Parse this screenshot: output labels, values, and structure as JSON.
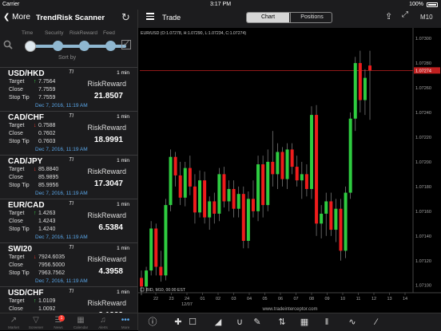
{
  "status_bar": {
    "carrier": "Carrier",
    "time": "3:17 PM",
    "battery": "100%"
  },
  "left_panel": {
    "back_label": "More",
    "title": "TrendRisk Scanner",
    "sort": {
      "options": [
        "Time",
        "Security",
        "RiskReward",
        "Feed"
      ],
      "label": "Sort by"
    },
    "items": [
      {
        "symbol": "USD/HKD",
        "ti": "TI",
        "timeframe": "1 min",
        "direction": "up",
        "target": "7.7564",
        "close": "7.7559",
        "stop": "7.7559",
        "rr_label": "RiskReward",
        "score": "21.8507",
        "date": "Dec 7, 2016, 11:19 AM",
        "labels": {
          "target": "Target",
          "close": "Close",
          "stop": "Stop Tip"
        }
      },
      {
        "symbol": "CAD/CHF",
        "ti": "TI",
        "timeframe": "1 min",
        "direction": "down",
        "target": "0.7588",
        "close": "0.7602",
        "stop": "0.7603",
        "rr_label": "RiskReward",
        "score": "18.9991",
        "date": "Dec 7, 2016, 11:19 AM",
        "labels": {
          "target": "Target",
          "close": "Close",
          "stop": "Stop Tip"
        }
      },
      {
        "symbol": "CAD/JPY",
        "ti": "TI",
        "timeframe": "1 min",
        "direction": "down",
        "target": "85.8840",
        "close": "85.9895",
        "stop": "85.9956",
        "rr_label": "RiskReward",
        "score": "17.3047",
        "date": "Dec 7, 2016, 11:19 AM",
        "labels": {
          "target": "Target",
          "close": "Close",
          "stop": "Stop Tip"
        }
      },
      {
        "symbol": "EUR/CAD",
        "ti": "TI",
        "timeframe": "1 min",
        "direction": "up",
        "target": "1.4263",
        "close": "1.4243",
        "stop": "1.4240",
        "rr_label": "RiskReward",
        "score": "6.5384",
        "date": "Dec 7, 2016, 11:19 AM",
        "labels": {
          "target": "Target",
          "close": "Close",
          "stop": "Stop Tip"
        }
      },
      {
        "symbol": "SWI20",
        "ti": "TI",
        "timeframe": "1 min",
        "direction": "down",
        "target": "7924.6035",
        "close": "7956.5000",
        "stop": "7963.7562",
        "rr_label": "RiskReward",
        "score": "4.3958",
        "date": "Dec 7, 2016, 11:19 AM",
        "labels": {
          "target": "Target",
          "close": "Close",
          "stop": "Stop Tip"
        }
      },
      {
        "symbol": "USD/CHF",
        "ti": "TI",
        "timeframe": "1 min",
        "direction": "up",
        "target": "1.0109",
        "close": "1.0092",
        "stop": "1.0086",
        "rr_label": "RiskReward",
        "score": "3.1333",
        "date": "",
        "labels": {
          "target": "Target",
          "close": "Close",
          "stop": "Stop Tip"
        }
      }
    ],
    "tabs": [
      {
        "label": "Market",
        "icon": "chart-icon"
      },
      {
        "label": "Screener",
        "icon": "filter-icon"
      },
      {
        "label": "News",
        "icon": "news-icon",
        "badge": "1"
      },
      {
        "label": "Calendar",
        "icon": "calendar-icon"
      },
      {
        "label": "Alerts",
        "icon": "bell-icon"
      },
      {
        "label": "More",
        "icon": "more-icon"
      }
    ]
  },
  "right_panel": {
    "title": "Trade",
    "segments": [
      "Chart",
      "Positions"
    ],
    "period": "M10",
    "chart_header": "EUR/USD (O:1.07278, H:1.07290, L:1.07234, C:1.07274)",
    "chart_footer": "BID, M10, 00:00 EST",
    "watermark": "www.tradeinterceptor.com",
    "toolbar_icons": [
      "info-icon",
      "crosshair-icon",
      "crop-icon",
      "area-chart-icon",
      "magnet-icon",
      "pencil-icon",
      "sort-icon",
      "grid-icon",
      "columns-icon",
      "indicator-icon",
      "link-icon"
    ]
  },
  "chart_data": {
    "type": "candlestick",
    "symbol": "EUR/USD",
    "y_ticks": [
      "1.07300",
      "1.07280",
      "1.07260",
      "1.07240",
      "1.07220",
      "1.07200",
      "1.07180",
      "1.07160",
      "1.07140",
      "1.07120",
      "1.07100"
    ],
    "x_ticks": [
      "22",
      "23",
      "24",
      "01",
      "02",
      "03",
      "04",
      "05",
      "06",
      "07",
      "08",
      "09",
      "10",
      "11",
      "12",
      "13",
      "14"
    ],
    "x_sublabel": "12/07",
    "last_price": "1.07274",
    "ylim": [
      1.07094,
      1.07302
    ],
    "up_color": "#2ecc40",
    "down_color": "#ee1c1c",
    "candles": [
      {
        "o": 1.07106,
        "h": 1.07112,
        "l": 1.07092,
        "c": 1.07099
      },
      {
        "o": 1.07099,
        "h": 1.07115,
        "l": 1.07094,
        "c": 1.07112
      },
      {
        "o": 1.07112,
        "h": 1.07152,
        "l": 1.07108,
        "c": 1.07146
      },
      {
        "o": 1.07146,
        "h": 1.0715,
        "l": 1.07108,
        "c": 1.07115
      },
      {
        "o": 1.07115,
        "h": 1.07128,
        "l": 1.07103,
        "c": 1.07108
      },
      {
        "o": 1.07108,
        "h": 1.0717,
        "l": 1.07104,
        "c": 1.07165
      },
      {
        "o": 1.07165,
        "h": 1.0721,
        "l": 1.0716,
        "c": 1.07204
      },
      {
        "o": 1.07204,
        "h": 1.07208,
        "l": 1.0718,
        "c": 1.07189
      },
      {
        "o": 1.07189,
        "h": 1.072,
        "l": 1.07165,
        "c": 1.07171
      },
      {
        "o": 1.07171,
        "h": 1.072,
        "l": 1.07164,
        "c": 1.07195
      },
      {
        "o": 1.07195,
        "h": 1.07205,
        "l": 1.07173,
        "c": 1.0718
      },
      {
        "o": 1.0718,
        "h": 1.0719,
        "l": 1.0715,
        "c": 1.07159
      },
      {
        "o": 1.07159,
        "h": 1.07193,
        "l": 1.07155,
        "c": 1.07185
      },
      {
        "o": 1.07185,
        "h": 1.07192,
        "l": 1.0715,
        "c": 1.07155
      },
      {
        "o": 1.07155,
        "h": 1.07172,
        "l": 1.07145,
        "c": 1.07168
      },
      {
        "o": 1.07168,
        "h": 1.07175,
        "l": 1.0715,
        "c": 1.07158
      },
      {
        "o": 1.07158,
        "h": 1.07195,
        "l": 1.07152,
        "c": 1.0719
      },
      {
        "o": 1.0719,
        "h": 1.07196,
        "l": 1.07163,
        "c": 1.07168
      },
      {
        "o": 1.07168,
        "h": 1.07185,
        "l": 1.0716,
        "c": 1.07178
      },
      {
        "o": 1.07178,
        "h": 1.07185,
        "l": 1.07155,
        "c": 1.07162
      },
      {
        "o": 1.07162,
        "h": 1.0718,
        "l": 1.07155,
        "c": 1.07174
      },
      {
        "o": 1.07174,
        "h": 1.0718,
        "l": 1.0713,
        "c": 1.07136
      },
      {
        "o": 1.07136,
        "h": 1.07176,
        "l": 1.0713,
        "c": 1.0717
      },
      {
        "o": 1.0717,
        "h": 1.07185,
        "l": 1.07155,
        "c": 1.0716
      },
      {
        "o": 1.0716,
        "h": 1.07205,
        "l": 1.07152,
        "c": 1.07198
      },
      {
        "o": 1.07198,
        "h": 1.07205,
        "l": 1.07155,
        "c": 1.07165
      },
      {
        "o": 1.07165,
        "h": 1.0721,
        "l": 1.0716,
        "c": 1.072
      },
      {
        "o": 1.072,
        "h": 1.07225,
        "l": 1.0718,
        "c": 1.0719
      },
      {
        "o": 1.0719,
        "h": 1.07215,
        "l": 1.07178,
        "c": 1.07208
      },
      {
        "o": 1.07208,
        "h": 1.07212,
        "l": 1.0718,
        "c": 1.07186
      },
      {
        "o": 1.07186,
        "h": 1.07215,
        "l": 1.07178,
        "c": 1.0721
      },
      {
        "o": 1.0721,
        "h": 1.07215,
        "l": 1.0719,
        "c": 1.07196
      },
      {
        "o": 1.07196,
        "h": 1.07205,
        "l": 1.0718,
        "c": 1.07185
      },
      {
        "o": 1.07185,
        "h": 1.072,
        "l": 1.0717,
        "c": 1.0719
      },
      {
        "o": 1.0719,
        "h": 1.07198,
        "l": 1.07172,
        "c": 1.07178
      },
      {
        "o": 1.07178,
        "h": 1.07245,
        "l": 1.0717,
        "c": 1.07238
      },
      {
        "o": 1.07238,
        "h": 1.07246,
        "l": 1.0714,
        "c": 1.0715
      },
      {
        "o": 1.0715,
        "h": 1.07165,
        "l": 1.07138,
        "c": 1.07158
      },
      {
        "o": 1.07158,
        "h": 1.07175,
        "l": 1.0714,
        "c": 1.07168
      },
      {
        "o": 1.07168,
        "h": 1.07175,
        "l": 1.0714,
        "c": 1.07145
      },
      {
        "o": 1.07145,
        "h": 1.0717,
        "l": 1.07135,
        "c": 1.07162
      },
      {
        "o": 1.07162,
        "h": 1.0717,
        "l": 1.0712,
        "c": 1.07128
      },
      {
        "o": 1.07128,
        "h": 1.0718,
        "l": 1.07122,
        "c": 1.07175
      },
      {
        "o": 1.07175,
        "h": 1.0724,
        "l": 1.0717,
        "c": 1.07235
      },
      {
        "o": 1.07235,
        "h": 1.07285,
        "l": 1.07225,
        "c": 1.0728
      },
      {
        "o": 1.0728,
        "h": 1.0729,
        "l": 1.0724,
        "c": 1.0725
      },
      {
        "o": 1.0725,
        "h": 1.07275,
        "l": 1.07238,
        "c": 1.07268
      },
      {
        "o": 1.07278,
        "h": 1.0729,
        "l": 1.07234,
        "c": 1.07274
      }
    ]
  }
}
